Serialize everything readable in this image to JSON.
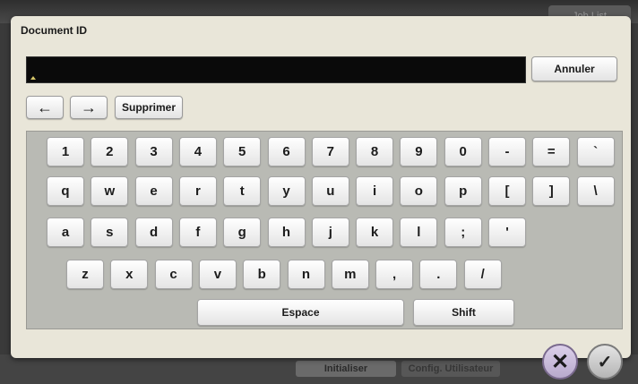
{
  "background": {
    "job_list_label": "Job List",
    "bottom_buttons": [
      "Initialiser",
      "Config. Utilisateur"
    ]
  },
  "dialog": {
    "title": "Document ID",
    "input_value": "",
    "cancel_label": "Annuler",
    "delete_label": "Supprimer",
    "left_arrow": "←",
    "right_arrow": "→"
  },
  "keyboard": {
    "rows": [
      [
        "1",
        "2",
        "3",
        "4",
        "5",
        "6",
        "7",
        "8",
        "9",
        "0",
        "-",
        "=",
        "`"
      ],
      [
        "q",
        "w",
        "e",
        "r",
        "t",
        "y",
        "u",
        "i",
        "o",
        "p",
        "[",
        "]",
        "\\"
      ],
      [
        "a",
        "s",
        "d",
        "f",
        "g",
        "h",
        "j",
        "k",
        "l",
        ";",
        "'"
      ],
      [
        "z",
        "x",
        "c",
        "v",
        "b",
        "n",
        "m",
        ",",
        ".",
        "/"
      ]
    ],
    "space_label": "Espace",
    "shift_label": "Shift"
  },
  "footer": {
    "cancel_symbol": "✕",
    "ok_symbol": "✓"
  }
}
